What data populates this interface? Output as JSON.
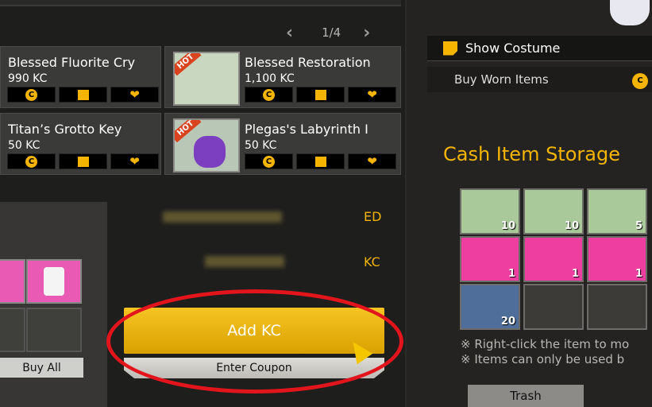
{
  "pager": {
    "prev": "‹",
    "current": "1/4",
    "next": "›"
  },
  "shop_items": [
    {
      "name": "Blessed Fluorite Cry",
      "price": "990 KC",
      "hot": false
    },
    {
      "name": "Blessed Restoration",
      "price": "1,100 KC",
      "hot": true,
      "hot_label": "HOT"
    },
    {
      "name": "Titan’s Grotto Key",
      "price": "50 KC",
      "hot": false
    },
    {
      "name": "Plegas's Labyrinth I",
      "price": "50 KC",
      "hot": true,
      "hot_label": "HOT"
    }
  ],
  "item_buttons": {
    "coin": "C",
    "gift": "",
    "heart": "❤"
  },
  "currency": {
    "ed_label": "ED",
    "kc_label": "KC"
  },
  "actions": {
    "add_kc": "Add KC",
    "enter_coupon": "Enter Coupon",
    "buy_all": "Buy All",
    "trash": "Trash"
  },
  "right_panel": {
    "show_costume": "Show Costume",
    "buy_worn_items": "Buy Worn Items",
    "cash_storage_title": "Cash Item Storage",
    "storage_qty": [
      "10",
      "10",
      "5",
      "1",
      "1",
      "1",
      "20"
    ],
    "notes": [
      "※ Right-click the item to mo",
      "※ Items can only be used b"
    ]
  },
  "colors": {
    "accent": "#f4b400",
    "highlight": "#e2141c"
  }
}
